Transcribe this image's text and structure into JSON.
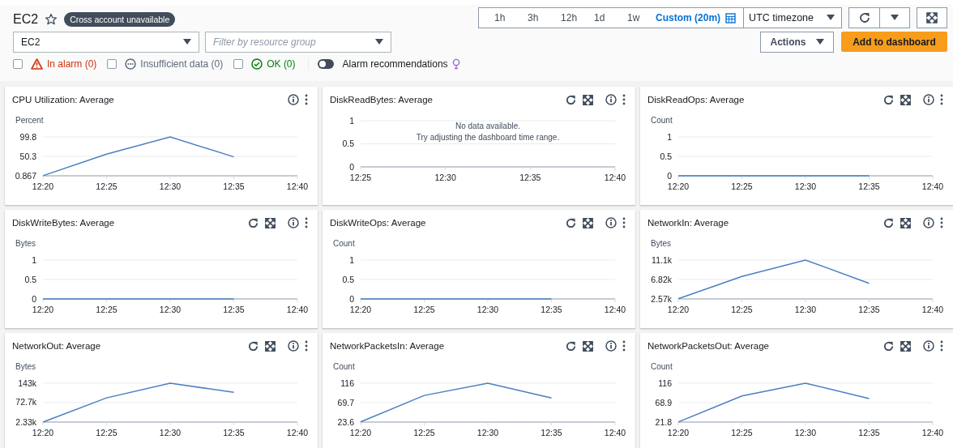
{
  "header": {
    "title": "EC2",
    "favorite": false,
    "badge": "Cross account unavailable"
  },
  "time_range": [
    {
      "label": "1h",
      "selected": false
    },
    {
      "label": "3h",
      "selected": false
    },
    {
      "label": "12h",
      "selected": false
    },
    {
      "label": "1d",
      "selected": false
    },
    {
      "label": "1w",
      "selected": false
    },
    {
      "label": "Custom (20m)",
      "selected": true
    }
  ],
  "timezone": {
    "value": "UTC timezone"
  },
  "service_select": {
    "value": "EC2"
  },
  "resource_group_select": {
    "placeholder": "Filter by resource group"
  },
  "actions": {
    "actions_button": "Actions",
    "add_button": "Add to dashboard"
  },
  "filters": [
    {
      "kind": "alarm",
      "label": "In alarm (0)",
      "checked": false
    },
    {
      "kind": "insufficient",
      "label": "Insufficient data (0)",
      "checked": false
    },
    {
      "kind": "ok",
      "label": "OK (0)",
      "checked": false
    }
  ],
  "alarm_recommendations": {
    "label": "Alarm recommendations",
    "on": false
  },
  "widgets": [
    {
      "title": "CPU Utilization: Average",
      "refreshable": false,
      "chart_data": {
        "type": "line",
        "ylabel": "Percent",
        "x": [
          "12:20",
          "12:25",
          "12:30",
          "12:35",
          "12:40"
        ],
        "ylim": [
          0.867,
          99.8
        ],
        "series": [
          {
            "color": "#4a7fc1",
            "values": [
              1,
              56,
              99.8,
              49,
              null
            ]
          }
        ],
        "yticks": [
          {
            "value": 0.867,
            "label": "0.867"
          },
          {
            "value": 50.3,
            "label": "50.3"
          },
          {
            "value": 99.8,
            "label": "99.8"
          }
        ]
      }
    },
    {
      "title": "DiskReadBytes: Average",
      "refreshable": true,
      "message": [
        "No data available.",
        "Try adjusting the dashboard time range."
      ],
      "chart_data": {
        "type": "line",
        "x": [
          "12:25",
          "12:30",
          "12:35",
          "12:40"
        ],
        "ylim": [
          0,
          1
        ],
        "yticks": [
          {
            "value": 0,
            "label": "0"
          },
          {
            "value": 0.5,
            "label": "0.5"
          },
          {
            "value": 1,
            "label": "1"
          }
        ]
      }
    },
    {
      "title": "DiskReadOps: Average",
      "refreshable": true,
      "chart_data": {
        "type": "line",
        "ylabel": "Count",
        "x": [
          "12:20",
          "12:25",
          "12:30",
          "12:35",
          "12:40"
        ],
        "ylim": [
          0,
          1
        ],
        "series": [
          {
            "color": "#4a7fc1",
            "values": [
              0,
              0,
              0,
              0,
              null
            ]
          }
        ],
        "yticks": [
          {
            "value": 0,
            "label": "0"
          },
          {
            "value": 0.5,
            "label": "0.5"
          },
          {
            "value": 1,
            "label": "1"
          }
        ]
      }
    },
    {
      "title": "DiskWriteBytes: Average",
      "refreshable": true,
      "chart_data": {
        "type": "line",
        "ylabel": "Bytes",
        "x": [
          "12:20",
          "12:25",
          "12:30",
          "12:35",
          "12:40"
        ],
        "ylim": [
          0,
          1
        ],
        "series": [
          {
            "color": "#4a7fc1",
            "values": [
              0,
              0,
              0,
              0,
              null
            ]
          }
        ],
        "yticks": [
          {
            "value": 0,
            "label": "0"
          },
          {
            "value": 0.5,
            "label": "0.5"
          },
          {
            "value": 1,
            "label": "1"
          }
        ]
      }
    },
    {
      "title": "DiskWriteOps: Average",
      "refreshable": true,
      "chart_data": {
        "type": "line",
        "ylabel": "Count",
        "x": [
          "12:20",
          "12:25",
          "12:30",
          "12:35",
          "12:40"
        ],
        "ylim": [
          0,
          1
        ],
        "series": [
          {
            "color": "#4a7fc1",
            "values": [
              0,
              0,
              0,
              0,
              null
            ]
          }
        ],
        "yticks": [
          {
            "value": 0,
            "label": "0"
          },
          {
            "value": 0.5,
            "label": "0.5"
          },
          {
            "value": 1,
            "label": "1"
          }
        ]
      }
    },
    {
      "title": "NetworkIn: Average",
      "refreshable": true,
      "chart_data": {
        "type": "line",
        "ylabel": "Bytes",
        "x": [
          "12:20",
          "12:25",
          "12:30",
          "12:35",
          "12:40"
        ],
        "ylim": [
          2570,
          11100
        ],
        "series": [
          {
            "color": "#4a7fc1",
            "values": [
              2600,
              7500,
              11100,
              6000,
              null
            ]
          }
        ],
        "yticks": [
          {
            "value": 2570,
            "label": "2.57k"
          },
          {
            "value": 6820,
            "label": "6.82k"
          },
          {
            "value": 11100,
            "label": "11.1k"
          }
        ]
      }
    },
    {
      "title": "NetworkOut: Average",
      "refreshable": true,
      "chart_data": {
        "type": "line",
        "ylabel": "Bytes",
        "x": [
          "12:20",
          "12:25",
          "12:30",
          "12:35",
          "12:40"
        ],
        "ylim": [
          2330,
          143000
        ],
        "series": [
          {
            "color": "#4a7fc1",
            "values": [
              2330,
              90000,
              143000,
              110000,
              null
            ]
          }
        ],
        "yticks": [
          {
            "value": 2330,
            "label": "2.33k"
          },
          {
            "value": 72700,
            "label": "72.7k"
          },
          {
            "value": 143000,
            "label": "143k"
          }
        ]
      }
    },
    {
      "title": "NetworkPacketsIn: Average",
      "refreshable": true,
      "chart_data": {
        "type": "line",
        "ylabel": "Count",
        "x": [
          "12:20",
          "12:25",
          "12:30",
          "12:35",
          "12:40"
        ],
        "ylim": [
          23.6,
          116
        ],
        "series": [
          {
            "color": "#4a7fc1",
            "values": [
              24,
              87,
              116,
              81,
              null
            ]
          }
        ],
        "yticks": [
          {
            "value": 23.6,
            "label": "23.6"
          },
          {
            "value": 69.7,
            "label": "69.7"
          },
          {
            "value": 116,
            "label": "116"
          }
        ]
      }
    },
    {
      "title": "NetworkPacketsOut: Average",
      "refreshable": true,
      "chart_data": {
        "type": "line",
        "ylabel": "Count",
        "x": [
          "12:20",
          "12:25",
          "12:30",
          "12:35",
          "12:40"
        ],
        "ylim": [
          21.8,
          116
        ],
        "series": [
          {
            "color": "#4a7fc1",
            "values": [
              22,
              85,
              116,
              79,
              null
            ]
          }
        ],
        "yticks": [
          {
            "value": 21.8,
            "label": "21.8"
          },
          {
            "value": 68.9,
            "label": "68.9"
          },
          {
            "value": 116,
            "label": "116"
          }
        ]
      }
    }
  ]
}
